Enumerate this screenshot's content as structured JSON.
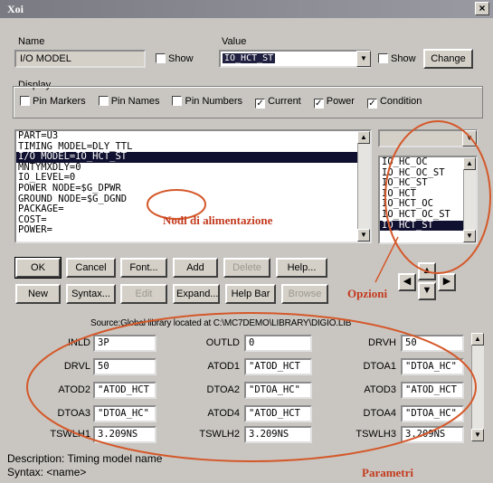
{
  "window": {
    "title": "Xoi",
    "close": "×"
  },
  "name_section": {
    "label": "Name",
    "value": "I/O MODEL",
    "show_label": "Show"
  },
  "value_section": {
    "label": "Value",
    "value": "IO_HCT_ST",
    "show_label": "Show",
    "change_label": "Change"
  },
  "display": {
    "label": "Display",
    "options": [
      {
        "label": "Pin Markers",
        "checked": false
      },
      {
        "label": "Pin Names",
        "checked": false
      },
      {
        "label": "Pin Numbers",
        "checked": false
      },
      {
        "label": "Current",
        "checked": true
      },
      {
        "label": "Power",
        "checked": true
      },
      {
        "label": "Condition",
        "checked": true
      }
    ]
  },
  "attributes": [
    "PART=U3",
    "TIMING MODEL=DLY_TTL",
    "I/O MODEL=IO_HCT_ST",
    "MNTYMXDLY=0",
    "IO_LEVEL=0",
    "POWER NODE=$G_DPWR",
    "GROUND NODE=$G_DGND",
    "PACKAGE=",
    "COST=",
    "POWER="
  ],
  "options_list": [
    "IO_HC_OC",
    "IO_HC_OC_ST",
    "IO_HC_ST",
    "IO_HCT",
    "IO_HCT_OC",
    "IO_HCT_OC_ST",
    "IO_HCT_ST"
  ],
  "buttons_row1": [
    "OK",
    "Cancel",
    "Font...",
    "Add",
    "Delete",
    "Help..."
  ],
  "buttons_row2": [
    "New",
    "Syntax...",
    "Edit",
    "Expand...",
    "Help Bar",
    "Browse"
  ],
  "source": "Source:Global library located at C:\\MC7DEMO\\LIBRARY\\DIGIO.LIB",
  "params": [
    {
      "label": "INLD",
      "value": "3P"
    },
    {
      "label": "OUTLD",
      "value": "0"
    },
    {
      "label": "DRVH",
      "value": "50"
    },
    {
      "label": "DRVL",
      "value": "50"
    },
    {
      "label": "ATOD1",
      "value": "\"ATOD_HCT"
    },
    {
      "label": "DTOA1",
      "value": "\"DTOA_HC\""
    },
    {
      "label": "ATOD2",
      "value": "\"ATOD_HCT"
    },
    {
      "label": "DTOA2",
      "value": "\"DTOA_HC\""
    },
    {
      "label": "ATOD3",
      "value": "\"ATOD_HCT"
    },
    {
      "label": "DTOA3",
      "value": "\"DTOA_HC\""
    },
    {
      "label": "ATOD4",
      "value": "\"ATOD_HCT"
    },
    {
      "label": "DTOA4",
      "value": "\"DTOA_HC\""
    },
    {
      "label": "TSWLH1",
      "value": "3.209NS"
    },
    {
      "label": "TSWLH2",
      "value": "3.209NS"
    },
    {
      "label": "TSWLH3",
      "value": "3.209NS"
    }
  ],
  "description": "Description: Timing model name",
  "syntax": "Syntax: <name>",
  "annotations": {
    "power_nodes": "Nodi di alimentazione",
    "options": "Opzioni",
    "params": "Parametri"
  },
  "colors": {
    "annotation": "#c33a1e",
    "selection": "#101030"
  }
}
